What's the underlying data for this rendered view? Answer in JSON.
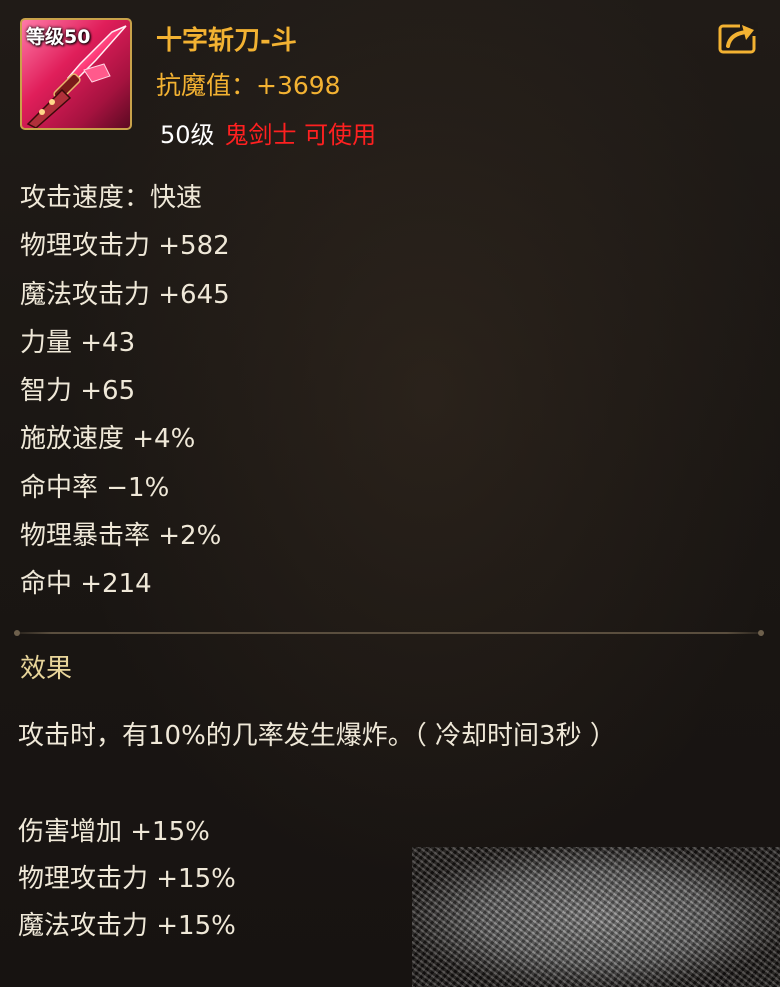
{
  "item": {
    "level_badge": "等级50",
    "name": "十字斩刀-斗",
    "resist": "抗魔值：+3698",
    "req_level": "50级",
    "req_class": "鬼剑士 可使用"
  },
  "stats": [
    "攻击速度：快速",
    "物理攻击力 +582",
    "魔法攻击力 +645",
    "力量 +43",
    "智力 +65",
    "施放速度 +4%",
    "命中率 −1%",
    "物理暴击率 +2%",
    "命中 +214"
  ],
  "effect": {
    "title": "效果",
    "description": "攻击时，有10%的几率发生爆炸。（ 冷却时间3秒 ）",
    "bonuses": [
      "伤害增加 +15%",
      "物理攻击力 +15%",
      "魔法攻击力 +15%"
    ]
  },
  "icons": {
    "item": "sword-item-icon",
    "share": "share-icon"
  },
  "colors": {
    "name": "#f3b232",
    "class_req": "#ff2020",
    "stat_text": "#efe8d8"
  }
}
